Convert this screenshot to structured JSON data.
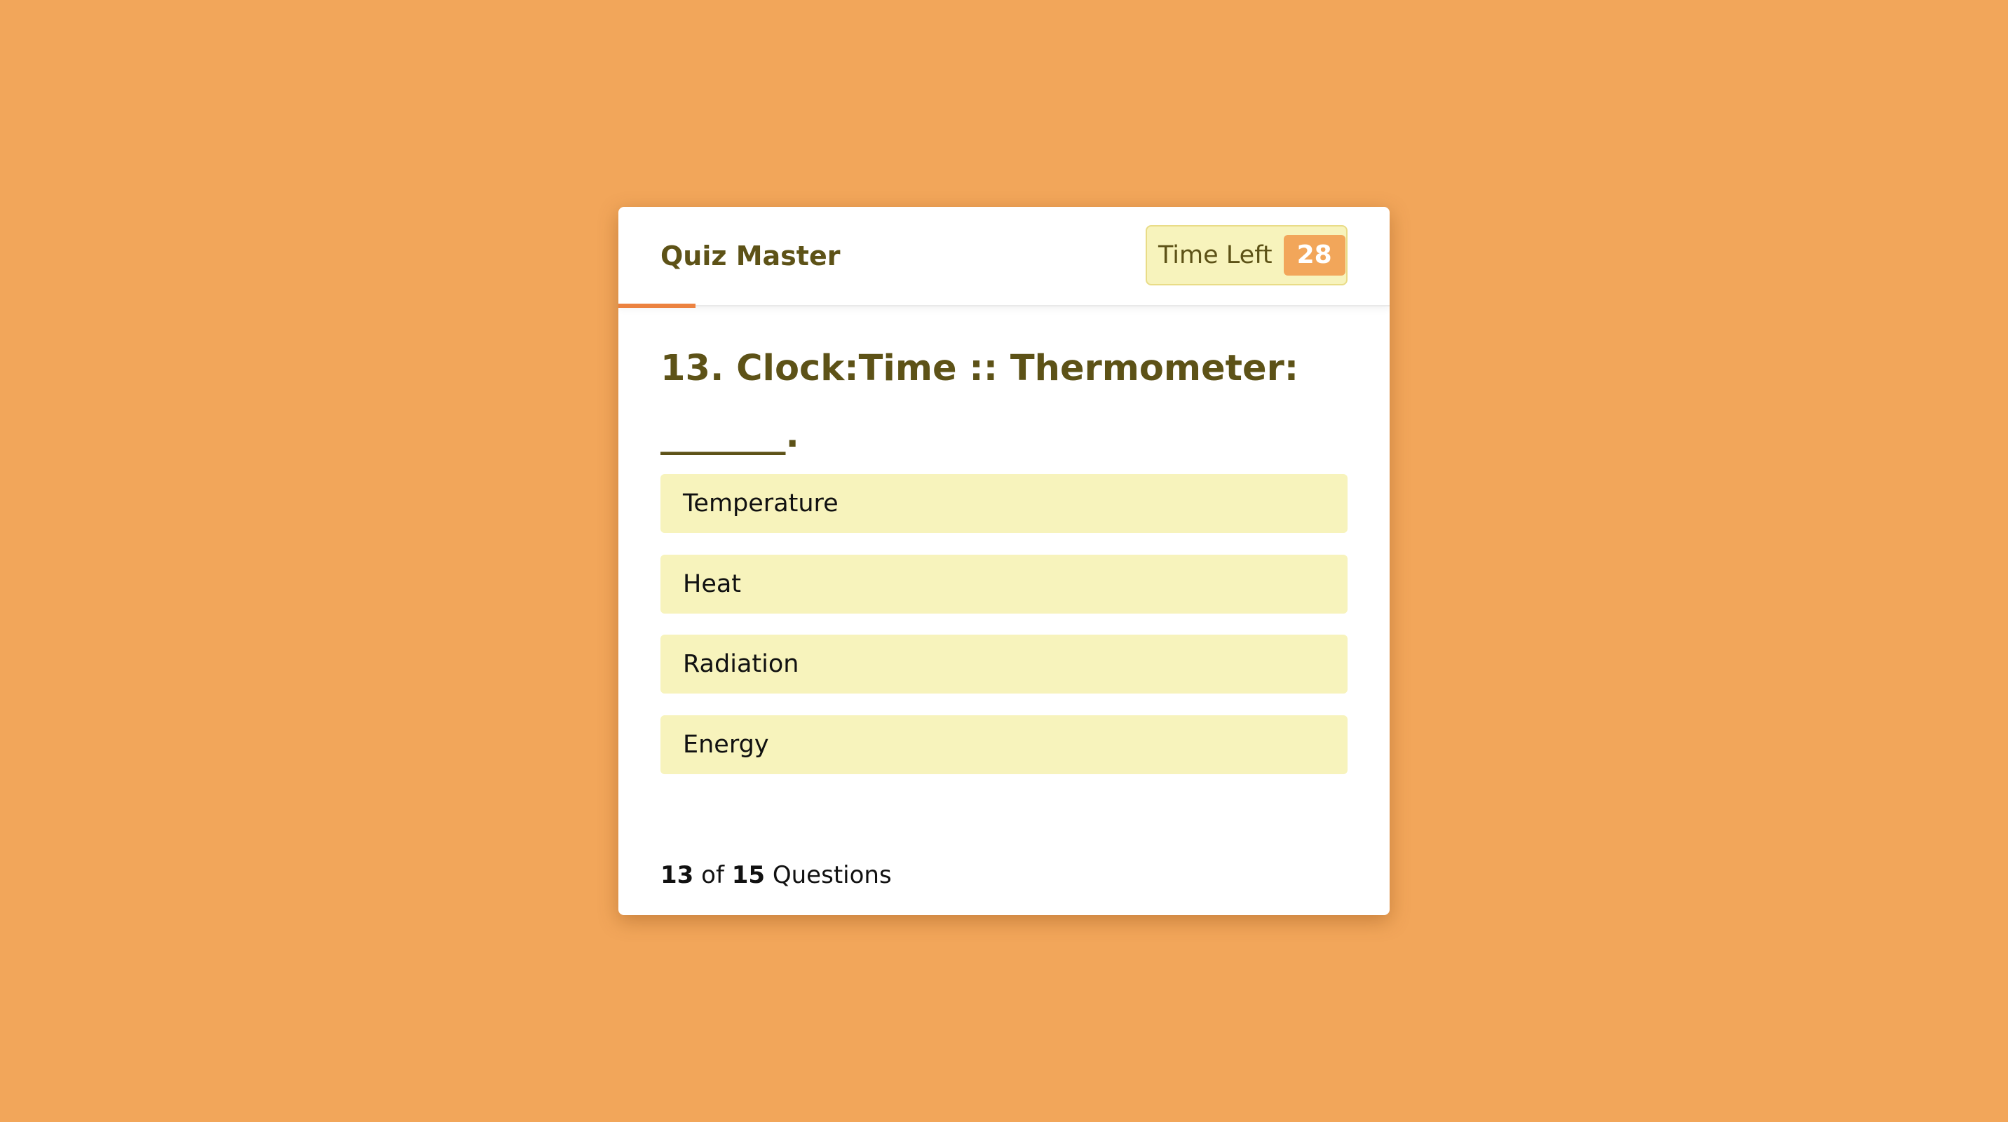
{
  "app": {
    "title": "Quiz Master"
  },
  "timer": {
    "label": "Time Left",
    "value": "28"
  },
  "question": {
    "text": "13. Clock:Time :: Thermometer: _______."
  },
  "options": [
    {
      "label": "Temperature"
    },
    {
      "label": "Heat"
    },
    {
      "label": "Radiation"
    },
    {
      "label": "Energy"
    }
  ],
  "progress": {
    "current": "13",
    "of_text": "of",
    "total": "15",
    "suffix": "Questions"
  },
  "colors": {
    "background": "#f2a65a",
    "accent": "#ec8240",
    "option_bg": "#f7f3bc",
    "title_text": "#5d5217"
  }
}
